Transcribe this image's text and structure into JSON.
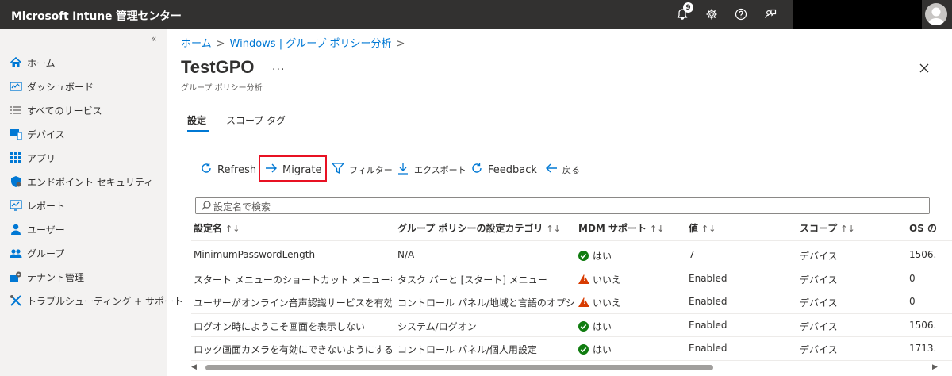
{
  "app": {
    "title": "Microsoft Intune 管理センター",
    "notification_count": "9"
  },
  "header_icons": [
    "bell-icon",
    "gear-icon",
    "help-icon",
    "feedback-icon"
  ],
  "sidebar": {
    "collapse": "«",
    "items": [
      {
        "label": "ホーム",
        "icon": "home-icon"
      },
      {
        "label": "ダッシュボード",
        "icon": "dashboard-icon"
      },
      {
        "label": "すべてのサービス",
        "icon": "list-icon"
      },
      {
        "label": "デバイス",
        "icon": "devices-icon"
      },
      {
        "label": "アプリ",
        "icon": "apps-icon"
      },
      {
        "label": "エンドポイント セキュリティ",
        "icon": "shield-icon"
      },
      {
        "label": "レポート",
        "icon": "reports-icon"
      },
      {
        "label": "ユーザー",
        "icon": "user-icon"
      },
      {
        "label": "グループ",
        "icon": "group-icon"
      },
      {
        "label": "テナント管理",
        "icon": "tenant-icon"
      },
      {
        "label": "トラブルシューティング + サポート",
        "icon": "wrench-icon"
      }
    ]
  },
  "breadcrumb": {
    "home": "ホーム",
    "sep": ">",
    "section": "Windows | グループ ポリシー分析",
    "trail": ">"
  },
  "page": {
    "title": "TestGPO",
    "more": "...",
    "subtitle": "グループ ポリシー分析",
    "close": "×"
  },
  "tabs": [
    {
      "label": "設定",
      "active": true
    },
    {
      "label": "スコープ タグ",
      "active": false
    }
  ],
  "toolbar": {
    "refresh": "Refresh",
    "migrate": "Migrate",
    "filter": "フィルター",
    "export": "エクスポート",
    "feedback": "Feedback",
    "back": "戻る"
  },
  "search": {
    "placeholder": "設定名で検索"
  },
  "table": {
    "sort_glyph": "↑↓",
    "columns": [
      "設定名",
      "グループ ポリシーの設定カテゴリ",
      "MDM サポート",
      "値",
      "スコープ",
      "OS の"
    ],
    "rows": [
      {
        "name": "MinimumPasswordLength",
        "category": "N/A",
        "mdm": "はい",
        "mdm_status": "ok",
        "value": "7",
        "scope": "デバイス",
        "os": "1506."
      },
      {
        "name": "スタート メニューのショートカット メニューを無効にする",
        "category": "タスク バーと [スタート] メニュー",
        "mdm": "いいえ",
        "mdm_status": "warn",
        "value": "Enabled",
        "scope": "デバイス",
        "os": "0"
      },
      {
        "name": "ユーザーがオンライン音声認識サービスを有効にで…",
        "category": "コントロール パネル/地域と言語のオプション",
        "mdm": "いいえ",
        "mdm_status": "warn",
        "value": "Enabled",
        "scope": "デバイス",
        "os": "0"
      },
      {
        "name": "ログオン時にようこそ画面を表示しない",
        "category": "システム/ログオン",
        "mdm": "はい",
        "mdm_status": "ok",
        "value": "Enabled",
        "scope": "デバイス",
        "os": "1506."
      },
      {
        "name": "ロック画面カメラを有効にできないようにする",
        "category": "コントロール パネル/個人用設定",
        "mdm": "はい",
        "mdm_status": "ok",
        "value": "Enabled",
        "scope": "デバイス",
        "os": "1713."
      }
    ]
  },
  "scroll": {
    "left": "◀",
    "right": "▶"
  },
  "colors": {
    "topbar": "#323130",
    "accent": "#0078d4",
    "highlight": "#e81123",
    "ok": "#107c10",
    "warn": "#d83b01"
  }
}
